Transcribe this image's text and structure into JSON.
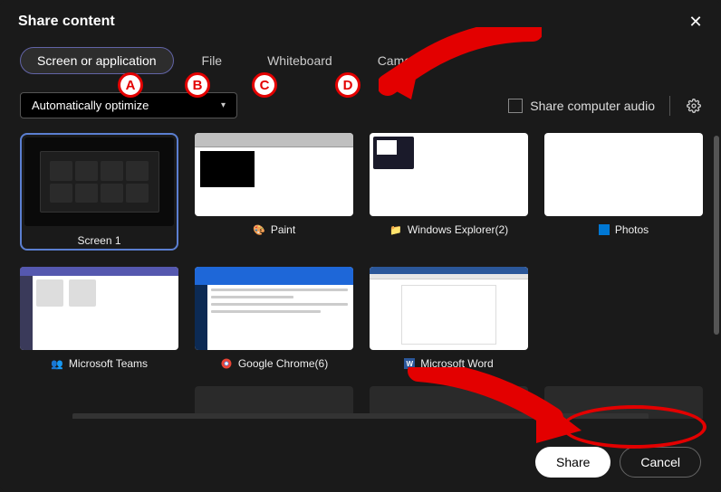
{
  "header": {
    "title": "Share content",
    "close_label": "✕"
  },
  "tabs": {
    "screen_or_app": "Screen or application",
    "file": "File",
    "whiteboard": "Whiteboard",
    "camera": "Camera"
  },
  "options": {
    "dropdown_value": "Automatically optimize",
    "share_audio_label": "Share computer audio"
  },
  "tiles": {
    "screen1": "Screen 1",
    "paint": "Paint",
    "explorer": "Windows Explorer(2)",
    "photos": "Photos",
    "teams": "Microsoft Teams",
    "chrome": "Google Chrome(6)",
    "word": "Microsoft Word"
  },
  "footer": {
    "share": "Share",
    "cancel": "Cancel"
  },
  "annotations": {
    "a": "A",
    "b": "B",
    "c": "C",
    "d": "D"
  }
}
